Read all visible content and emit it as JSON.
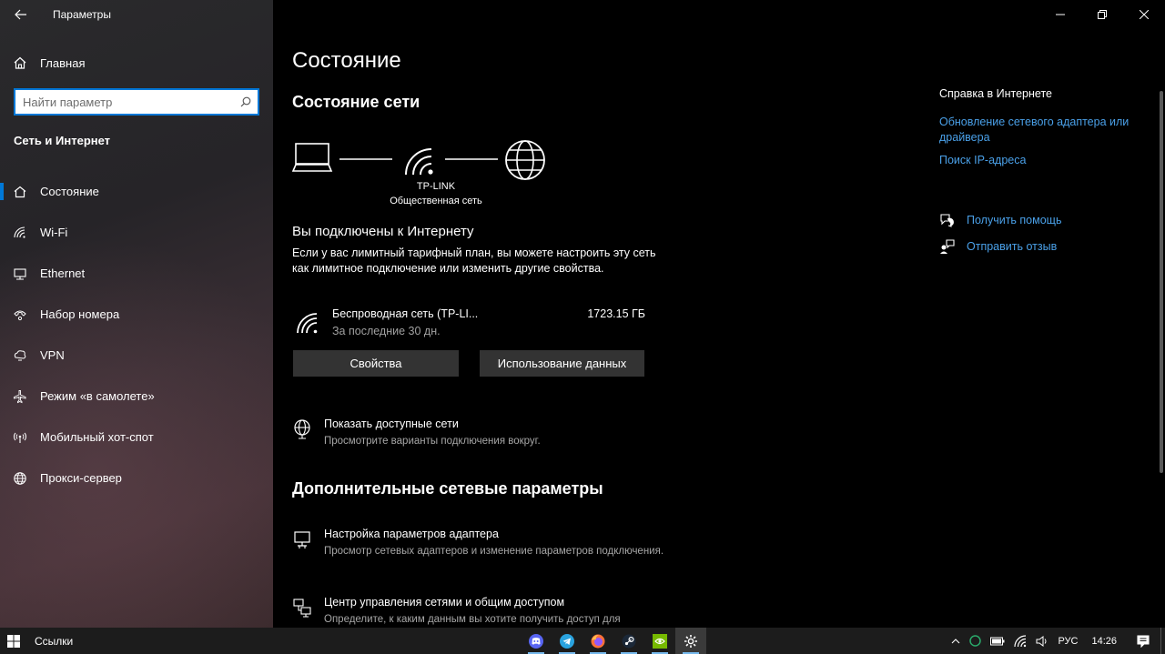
{
  "app": {
    "title": "Параметры"
  },
  "sidebar": {
    "home_label": "Главная",
    "search_placeholder": "Найти параметр",
    "section_title": "Сеть и Интернет",
    "items": [
      {
        "label": "Состояние",
        "icon": "home-status-icon",
        "active": true
      },
      {
        "label": "Wi-Fi",
        "icon": "wifi-icon"
      },
      {
        "label": "Ethernet",
        "icon": "ethernet-icon"
      },
      {
        "label": "Набор номера",
        "icon": "dialup-icon"
      },
      {
        "label": "VPN",
        "icon": "vpn-icon"
      },
      {
        "label": "Режим «в самолете»",
        "icon": "airplane-icon"
      },
      {
        "label": "Мобильный хот-спот",
        "icon": "hotspot-icon"
      },
      {
        "label": "Прокси-сервер",
        "icon": "globe-icon"
      }
    ]
  },
  "main": {
    "page_title": "Состояние",
    "status_heading": "Состояние сети",
    "diagram": {
      "network_name": "TP-LINK",
      "network_type": "Общественная сеть"
    },
    "connected_title": "Вы подключены к Интернету",
    "connected_desc": "Если у вас лимитный тарифный план, вы можете настроить эту сеть как лимитное подключение или изменить другие свойства.",
    "adapter": {
      "name": "Беспроводная сеть (TP-LI...",
      "period": "За последние 30 дн.",
      "usage": "1723.15 ГБ"
    },
    "buttons": {
      "properties": "Свойства",
      "data_usage": "Использование данных"
    },
    "show_networks": {
      "title": "Показать доступные сети",
      "desc": "Просмотрите варианты подключения вокруг."
    },
    "advanced_heading": "Дополнительные сетевые параметры",
    "adapter_settings": {
      "title": "Настройка параметров адаптера",
      "desc": "Просмотр сетевых адаптеров и изменение параметров подключения."
    },
    "network_center": {
      "title": "Центр управления сетями и общим доступом",
      "desc": "Определите, к каким данным вы хотите получить доступ для"
    }
  },
  "right": {
    "help_title": "Справка в Интернете",
    "links": [
      "Обновление сетевого адаптера или драйвера",
      "Поиск IP-адреса"
    ],
    "get_help": "Получить помощь",
    "feedback": "Отправить отзыв"
  },
  "taskbar": {
    "links_label": "Ссылки",
    "apps": [
      "discord-icon",
      "telegram-icon",
      "firefox-icon",
      "steam-icon",
      "nvidia-icon",
      "settings-icon"
    ],
    "language": "РУС",
    "time": "14:26"
  },
  "colors": {
    "accent": "#0078d7",
    "link": "#4aa0e8",
    "button_bg": "#333333"
  }
}
